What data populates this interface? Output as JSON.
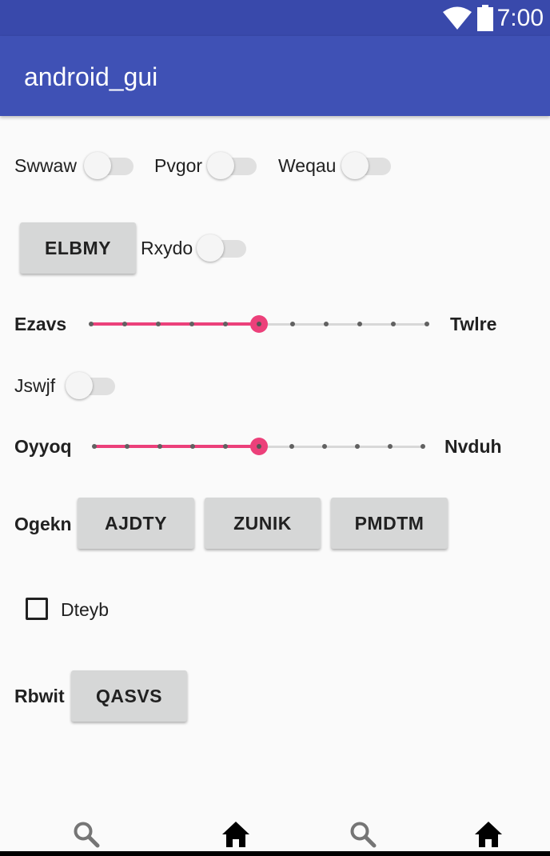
{
  "status_bar": {
    "time": "7:00"
  },
  "app": {
    "title": "android_gui"
  },
  "row1": {
    "switch1_label": "Swwaw",
    "switch2_label": "Pvgor",
    "switch3_label": "Weqau"
  },
  "row2": {
    "button_label": "ELBMY",
    "switch_label": "Rxydo"
  },
  "seek1": {
    "left_label": "Ezavs",
    "right_label": "Twlre",
    "value": 5,
    "max": 10
  },
  "row4": {
    "switch_label": "Jswjf"
  },
  "seek2": {
    "left_label": "Oyyoq",
    "right_label": "Nvduh",
    "value": 5,
    "max": 10
  },
  "row6": {
    "label": "Ogekn",
    "buttons": [
      "AJDTY",
      "ZUNIK",
      "PMDTM"
    ]
  },
  "row7": {
    "checkbox_label": "Dteyb",
    "checked": false
  },
  "row8": {
    "label": "Rbwit",
    "button_label": "QASVS"
  },
  "bottom_nav": {
    "icons": [
      "search-icon",
      "home-icon",
      "search-icon",
      "home-icon"
    ]
  },
  "colors": {
    "primary": "#3f51b5",
    "primary_dark": "#3949ab",
    "accent": "#ec407a"
  }
}
